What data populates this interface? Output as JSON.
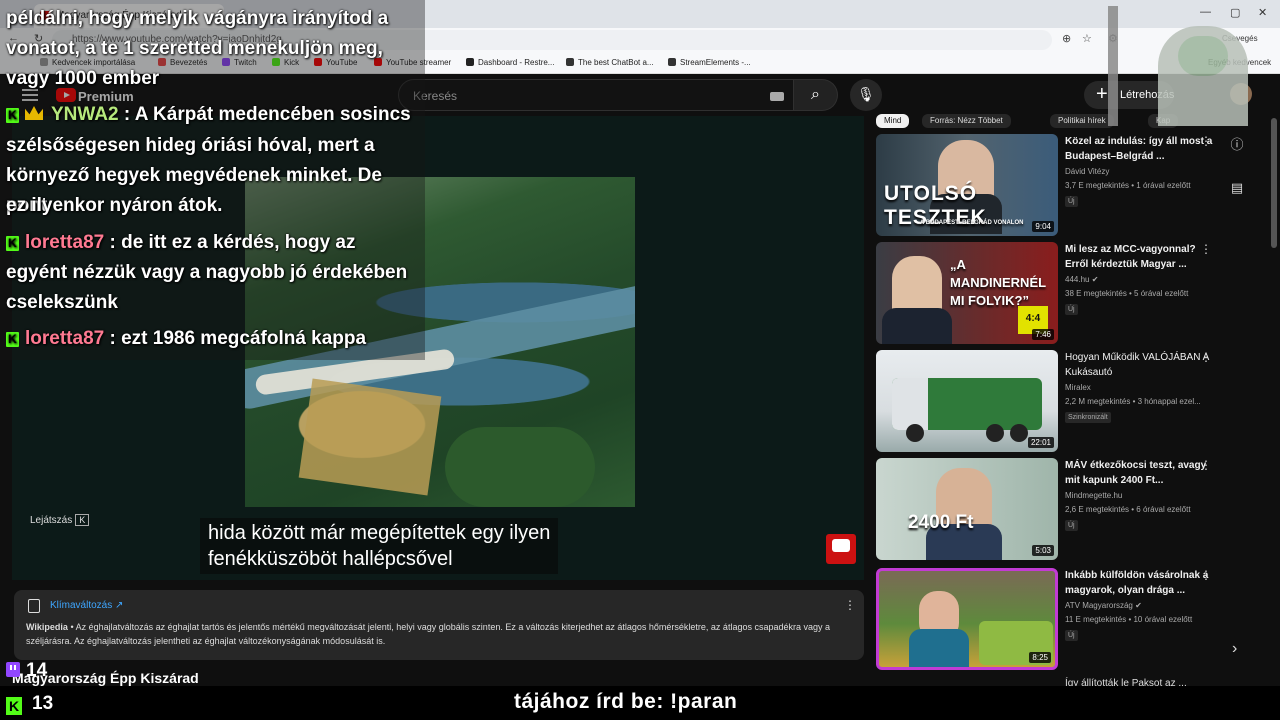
{
  "browser": {
    "tab_title": "Magyarország Épp Kiszárad",
    "url": "https://www.youtube.com/watch?v=iaoDnhitd2g",
    "cseveges": "Csevegés",
    "bookmarks": [
      "Kedvencek importálása",
      "Bevezetés",
      "Twitch",
      "Kick",
      "YouTube",
      "YouTube streamer",
      "Dashboard - Restre...",
      "The best ChatBot a...",
      "StreamElements -..."
    ],
    "other_bookmarks": "Egyéb kedvencek"
  },
  "yt_header": {
    "brand": "Premium",
    "search_placeholder": "Keresés",
    "create_label": "Létrehozás"
  },
  "player": {
    "subtitle_line1": "hida között már megépítettek egy ilyen",
    "subtitle_line2": "fenékküszöböt hallépcsővel",
    "play_hint": "Lejátszás",
    "play_key": "K"
  },
  "info_card": {
    "title": "Klímaváltozás ↗",
    "source": "Wikipedia",
    "text": " • Az éghajlatváltozás az éghajlat tartós és jelentős mértékű megváltozását jelenti, helyi vagy globális szinten. Ez a változás kiterjedhet az átlagos hőmérsékletre, az átlagos csapadékra vagy a széljárásra. Az éghajlatváltozás jelentheti az éghajlat változékonyságának módosulását is."
  },
  "video_title": "Magyarország Épp Kiszárad",
  "chips": [
    "Mind",
    "Forrás: Nézz Többet",
    "Politikai hírek",
    "Kap"
  ],
  "recommendations": [
    {
      "title": "Közel az indulás: így áll most a Budapest–Belgrád ...",
      "channel": "Dávid Vitézy",
      "stats": "3,7 E megtekintés • 1 órával ezelőtt",
      "badge": "Új",
      "duration": "9:04",
      "thumb_text": "UTOLSÓ TESZTEK",
      "thumb_sub": "A BUDAPEST–BELGRÁD VONALON"
    },
    {
      "title": "Mi lesz az MCC-vagyonnal? Erről kérdeztük Magyar ...",
      "channel": "444.hu",
      "stats": "38 E megtekintés • 5 órával ezelőtt",
      "badge": "Új",
      "duration": "7:46",
      "thumb_text": "„A MANDINERNÉL MI FOLYIK?”",
      "thumb_sub": "4:4"
    },
    {
      "title": "Hogyan Működik VALÓJÁBAN A Kukásautó",
      "channel": "Miralex",
      "stats": "2,2 M megtekintés • 3 hónappal ezel...",
      "badge": "Szinkronizált",
      "duration": "22:01",
      "thumb_text": "",
      "thumb_sub": ""
    },
    {
      "title": "MÁV étkezőkocsi teszt, avagy mit kapunk 2400 Ft...",
      "channel": "Mindmegette.hu",
      "stats": "2,6 E megtekintés • 6 órával ezelőtt",
      "badge": "Új",
      "duration": "5:03",
      "thumb_text": "2400 Ft",
      "thumb_sub": ""
    },
    {
      "title": "Inkább külföldön vásárolnak a magyarok, olyan drága ...",
      "channel": "ATV Magyarország",
      "stats": "11 E megtekintés • 10 órával ezelőtt",
      "badge": "Új",
      "duration": "8:25",
      "thumb_text": "",
      "thumb_sub": ""
    }
  ],
  "cut_title": "Így állították le Paksot az ...",
  "chat": {
    "top_line1": "példálni, hogy melyik vágányra irányítod a",
    "top_line2": "vonatot, a te 1 szeretted menekuljön meg,",
    "top_line3": "vagy 1000 ember",
    "m1_user": "YNWA2",
    "m1_l1": " : A Kárpát medencében sosincs",
    "m1_l2": "szélsőségesen hideg óriási hóval, mert a",
    "m1_l3": "környező hegyek megvédenek minket. De pont",
    "m1_l4": "ez ilyenkor nyáron átok.",
    "m2_user": "loretta87",
    "m2_l1": " : de itt ez a kérdés, hogy az",
    "m2_l2": "egyént nézzük vagy a nagyobb jó érdekében",
    "m2_l3": "cselekszünk",
    "m3_user": "loretta87",
    "m3_l1": " : ezt 1986 megcáfolná kappa"
  },
  "overlay": {
    "twitch_viewers": "14",
    "kick_viewers": "13",
    "ticker": "tájához írd be: !paran"
  },
  "colors": {
    "kick": "#53fc18",
    "twitch": "#9146ff",
    "yt_red": "#ff0000",
    "link": "#3ea6ff"
  }
}
